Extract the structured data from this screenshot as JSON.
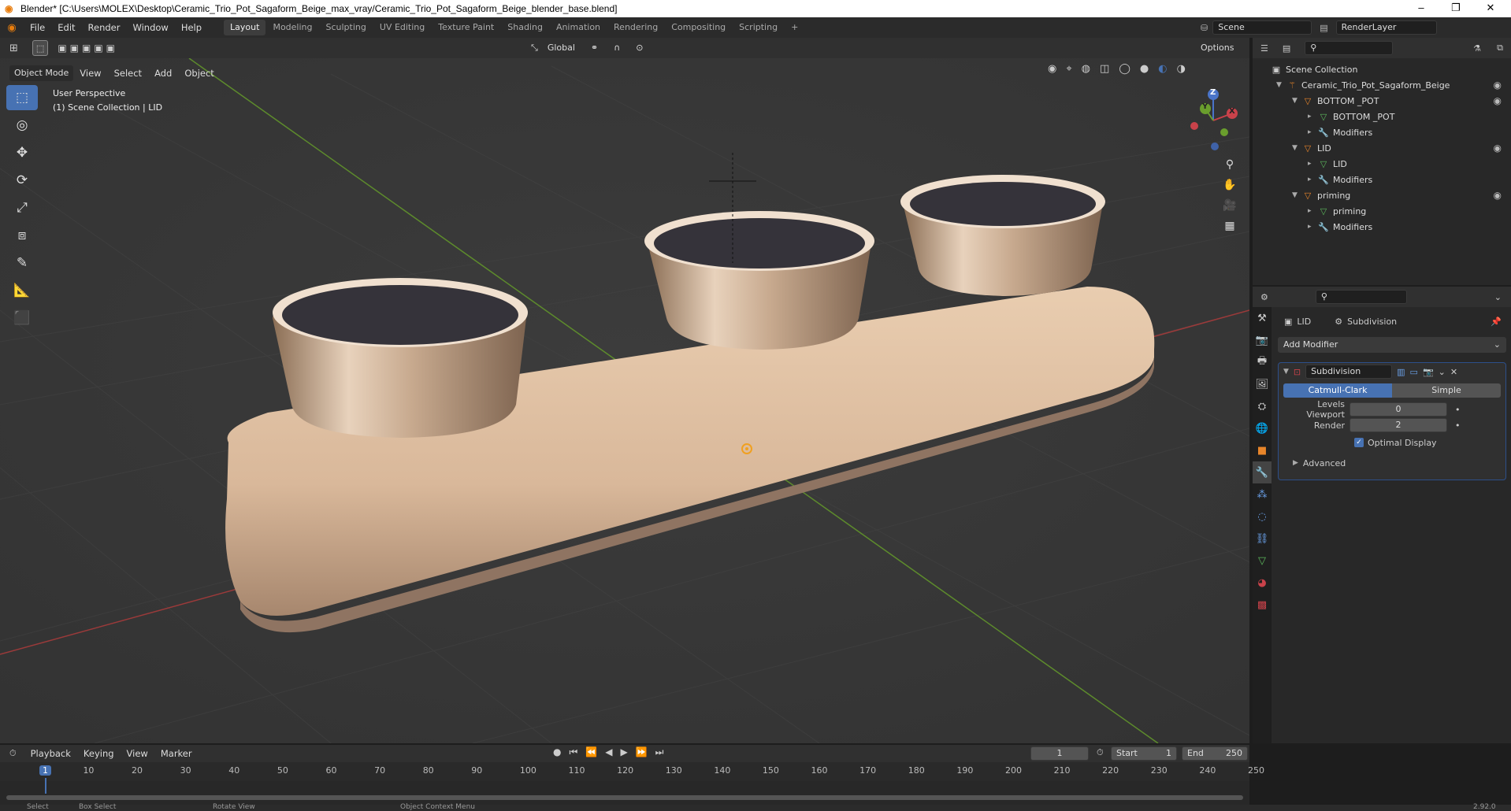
{
  "window": {
    "title": "Blender* [C:\\Users\\MOLEX\\Desktop\\Ceramic_Trio_Pot_Sagaform_Beige_max_vray/Ceramic_Trio_Pot_Sagaform_Beige_blender_base.blend]",
    "minimize": "–",
    "restore": "❐",
    "close": "✕"
  },
  "menu": [
    "File",
    "Edit",
    "Render",
    "Window",
    "Help"
  ],
  "workspaces": [
    "Layout",
    "Modeling",
    "Sculpting",
    "UV Editing",
    "Texture Paint",
    "Shading",
    "Animation",
    "Rendering",
    "Compositing",
    "Scripting"
  ],
  "add_workspace": "+",
  "scene": {
    "scene_name": "Scene",
    "view_layer": "RenderLayer"
  },
  "viewport_header": {
    "orientation": "Global",
    "options": "Options",
    "mode": "Object Mode",
    "menus": [
      "View",
      "Select",
      "Add",
      "Object"
    ]
  },
  "viewport": {
    "perspective": "User Perspective",
    "collection_info": "(1) Scene Collection | LID"
  },
  "gizmo": {
    "x": "X",
    "y": "Y",
    "z": "Z"
  },
  "outliner": {
    "root": "Scene Collection",
    "rows": [
      {
        "label": "Ceramic_Trio_Pot_Sagaform_Beige",
        "indent": 1,
        "icon": "armature-icon",
        "eye": true
      },
      {
        "label": "BOTTOM _POT",
        "indent": 2,
        "icon": "object-icon",
        "eye": true
      },
      {
        "label": "BOTTOM _POT",
        "indent": 3,
        "icon": "mesh-icon",
        "eye": false
      },
      {
        "label": "Modifiers",
        "indent": 3,
        "icon": "wrench-icon",
        "eye": false
      },
      {
        "label": "LID",
        "indent": 2,
        "icon": "object-icon",
        "eye": true
      },
      {
        "label": "LID",
        "indent": 3,
        "icon": "mesh-icon",
        "eye": false
      },
      {
        "label": "Modifiers",
        "indent": 3,
        "icon": "wrench-icon",
        "eye": false
      },
      {
        "label": "priming",
        "indent": 2,
        "icon": "object-icon",
        "eye": true
      },
      {
        "label": "priming",
        "indent": 3,
        "icon": "mesh-icon",
        "eye": false
      },
      {
        "label": "Modifiers",
        "indent": 3,
        "icon": "wrench-icon",
        "eye": false
      }
    ]
  },
  "properties": {
    "object": "LID",
    "modifier_crumb": "Subdivision",
    "add_modifier": "Add Modifier",
    "modifier": {
      "name": "Subdivision",
      "type_a": "Catmull-Clark",
      "type_b": "Simple",
      "levels_label": "Levels Viewport",
      "levels_value": "0",
      "render_label": "Render",
      "render_value": "2",
      "optimal": "Optimal Display",
      "advanced": "Advanced"
    }
  },
  "timeline": {
    "menus": [
      "Playback",
      "Keying",
      "View",
      "Marker"
    ],
    "current": "1",
    "start_label": "Start",
    "start": "1",
    "end_label": "End",
    "end": "250",
    "ticks": [
      "1",
      "10",
      "20",
      "30",
      "40",
      "50",
      "60",
      "70",
      "80",
      "90",
      "100",
      "110",
      "120",
      "130",
      "140",
      "150",
      "160",
      "170",
      "180",
      "190",
      "200",
      "210",
      "220",
      "230",
      "240",
      "250"
    ]
  },
  "status": {
    "select": "Select",
    "box": "Box Select",
    "rotate": "Rotate View",
    "context": "Object Context Menu",
    "version": "2.92.0"
  }
}
